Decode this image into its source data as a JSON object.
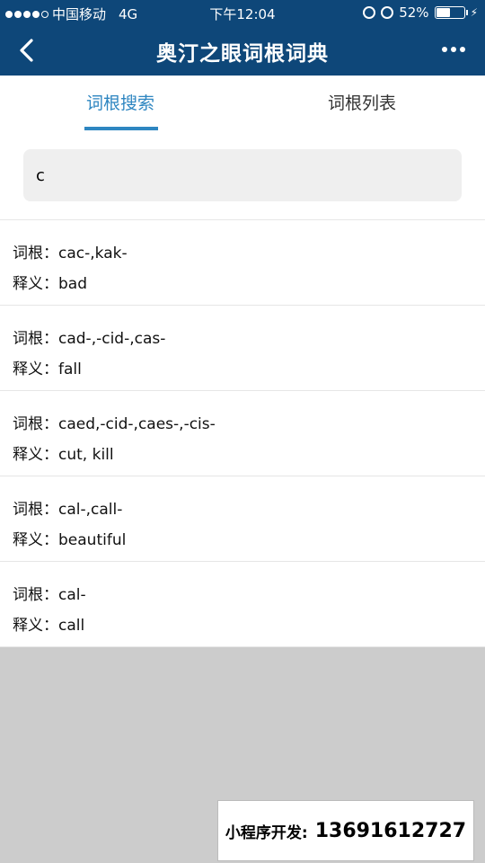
{
  "status_bar": {
    "carrier": "中国移动",
    "network": "4G",
    "time": "下午12:04",
    "battery": "52%",
    "battery_level": 0.52
  },
  "nav": {
    "title": "奥汀之眼词根词典"
  },
  "tabs": [
    {
      "label": "词根搜索",
      "active": true
    },
    {
      "label": "词根列表",
      "active": false
    }
  ],
  "search": {
    "value": "c"
  },
  "results": [
    {
      "root_label": "词根：",
      "root": "cac-,kak-",
      "meaning_label": "释义：",
      "meaning": "bad"
    },
    {
      "root_label": "词根：",
      "root": "cad-,-cid-,cas-",
      "meaning_label": "释义：",
      "meaning": "fall"
    },
    {
      "root_label": "词根：",
      "root": "caed,-cid-,caes-,-cis-",
      "meaning_label": "释义：",
      "meaning": "cut, kill"
    },
    {
      "root_label": "词根：",
      "root": "cal-,call-",
      "meaning_label": "释义：",
      "meaning": "beautiful"
    },
    {
      "root_label": "词根：",
      "root": "cal-",
      "meaning_label": "释义：",
      "meaning": "call"
    }
  ],
  "watermark": {
    "label": "小程序开发:",
    "number": "13691612727"
  },
  "colors": {
    "header": "#0e4779",
    "accent": "#2e86c1",
    "footer_gray": "#cccccc"
  }
}
